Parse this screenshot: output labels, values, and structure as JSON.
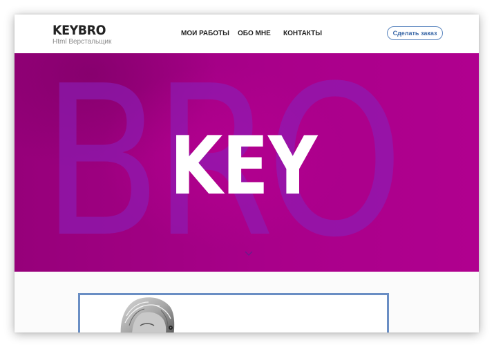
{
  "header": {
    "logo_title": "KEYBRO",
    "logo_subtitle": "Html Верстальщик",
    "nav": [
      {
        "label": "МОИ РАБОТЫ"
      },
      {
        "label": "ОБО МНЕ"
      },
      {
        "label": "КОНТАКТЫ"
      }
    ],
    "order_button": "Сделать заказ"
  },
  "hero": {
    "background_word": "BRO",
    "title": "KEY",
    "scroll_icon": "chevron-down-icon"
  },
  "about": {
    "photo_icon": "portrait-photo"
  },
  "colors": {
    "accent": "#5b86bf",
    "hero_bg": "#a5008a",
    "hero_letters": "#8a20b8"
  }
}
